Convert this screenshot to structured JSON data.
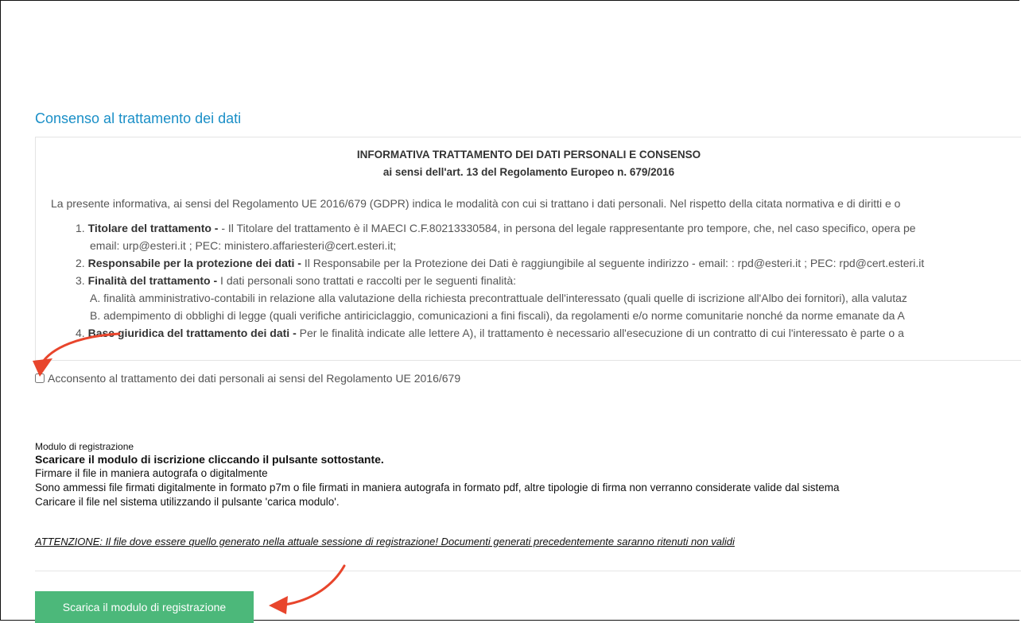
{
  "section_title": "Consenso al trattamento dei dati",
  "info": {
    "heading_1": "INFORMATIVA TRATTAMENTO DEI DATI PERSONALI E CONSENSO",
    "heading_2": "ai sensi dell'art. 13 del Regolamento Europeo n. 679/2016",
    "intro": "La presente informativa, ai sensi del Regolamento UE 2016/679 (GDPR) indica le modalità con cui si trattano i dati personali. Nel rispetto della citata normativa e di diritti e o",
    "items": [
      {
        "num": "1.",
        "title": "Titolare del trattamento -",
        "text": " - Il Titolare del trattamento è il MAECI C.F.80213330584, in persona del legale rappresentante pro tempore, che, nel caso specifico, opera pe"
      },
      {
        "num": "",
        "title": "",
        "text": "email: urp@esteri.it ; PEC: ministero.affariesteri@cert.esteri.it;"
      },
      {
        "num": "2.",
        "title": "Responsabile per la protezione dei dati -",
        "text": " Il Responsabile per la Protezione dei Dati è raggiungibile al seguente indirizzo - email: : rpd@esteri.it ; PEC: rpd@cert.esteri.it"
      },
      {
        "num": "3.",
        "title": "Finalità del trattamento -",
        "text": " I dati personali sono trattati e raccolti per le seguenti finalità:"
      },
      {
        "num": "",
        "title": "",
        "text": "A. finalità amministrativo-contabili in relazione alla valutazione della richiesta precontrattuale dell'interessato (quali quelle di iscrizione all'Albo dei fornitori), alla valutaz"
      },
      {
        "num": "",
        "title": "",
        "text": "B. adempimento di obblighi di legge (quali verifiche antiriciclaggio, comunicazioni a fini fiscali), da regolamenti e/o norme comunitarie nonché da norme emanate da A"
      },
      {
        "num": "4.",
        "title": "Base giuridica del trattamento dei dati -",
        "text": " Per le finalità indicate alle lettere A), il trattamento è necessario all'esecuzione di un contratto di cui l'interessato è parte o a"
      }
    ]
  },
  "consent_label": "Acconsento al trattamento dei dati personali ai sensi del Regolamento UE 2016/679",
  "module": {
    "label": "Modulo di registrazione",
    "bold_line": "Scaricare il modulo di iscrizione cliccando il pulsante sottostante.",
    "line_1": "Firmare il file in maniera autografa o digitalmente",
    "line_2": "Sono ammessi file firmati digitalmente in formato p7m o file firmati in maniera autografa in formato pdf, altre tipologie di firma non verranno considerate valide dal sistema",
    "line_3": "Caricare il file nel sistema utilizzando il pulsante 'carica modulo'."
  },
  "attention": "ATTENZIONE: Il file dove essere quello generato nella attuale sessione di registrazione! Documenti generati precedentemente saranno ritenuti non validi",
  "download_button": "Scarica il modulo di registrazione",
  "colors": {
    "accent": "#1a8fc7",
    "button": "#4cb87a",
    "annotation": "#e8452c"
  }
}
